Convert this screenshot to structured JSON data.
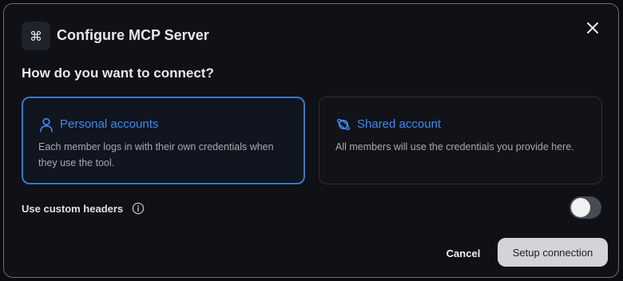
{
  "dialog": {
    "title": "Configure MCP Server",
    "header_icon": "⌘",
    "close_icon": "close-icon"
  },
  "question": "How do you want to connect?",
  "options": [
    {
      "title": "Personal accounts",
      "description": "Each member logs in with their own credentials when they use the tool.",
      "icon": "user-icon",
      "selected": true
    },
    {
      "title": "Shared account",
      "description": "All members will use the credentials you provide here.",
      "icon": "planet-icon",
      "selected": false
    }
  ],
  "custom_headers": {
    "label": "Use custom headers",
    "enabled": false,
    "icon": "info-icon"
  },
  "actions": {
    "cancel_label": "Cancel",
    "setup_label": "Setup connection"
  },
  "colors": {
    "accent": "#3d8bf0",
    "selected_border": "#3a78c4",
    "background": "#0f1116",
    "primary_button": "#d4d4d6"
  }
}
